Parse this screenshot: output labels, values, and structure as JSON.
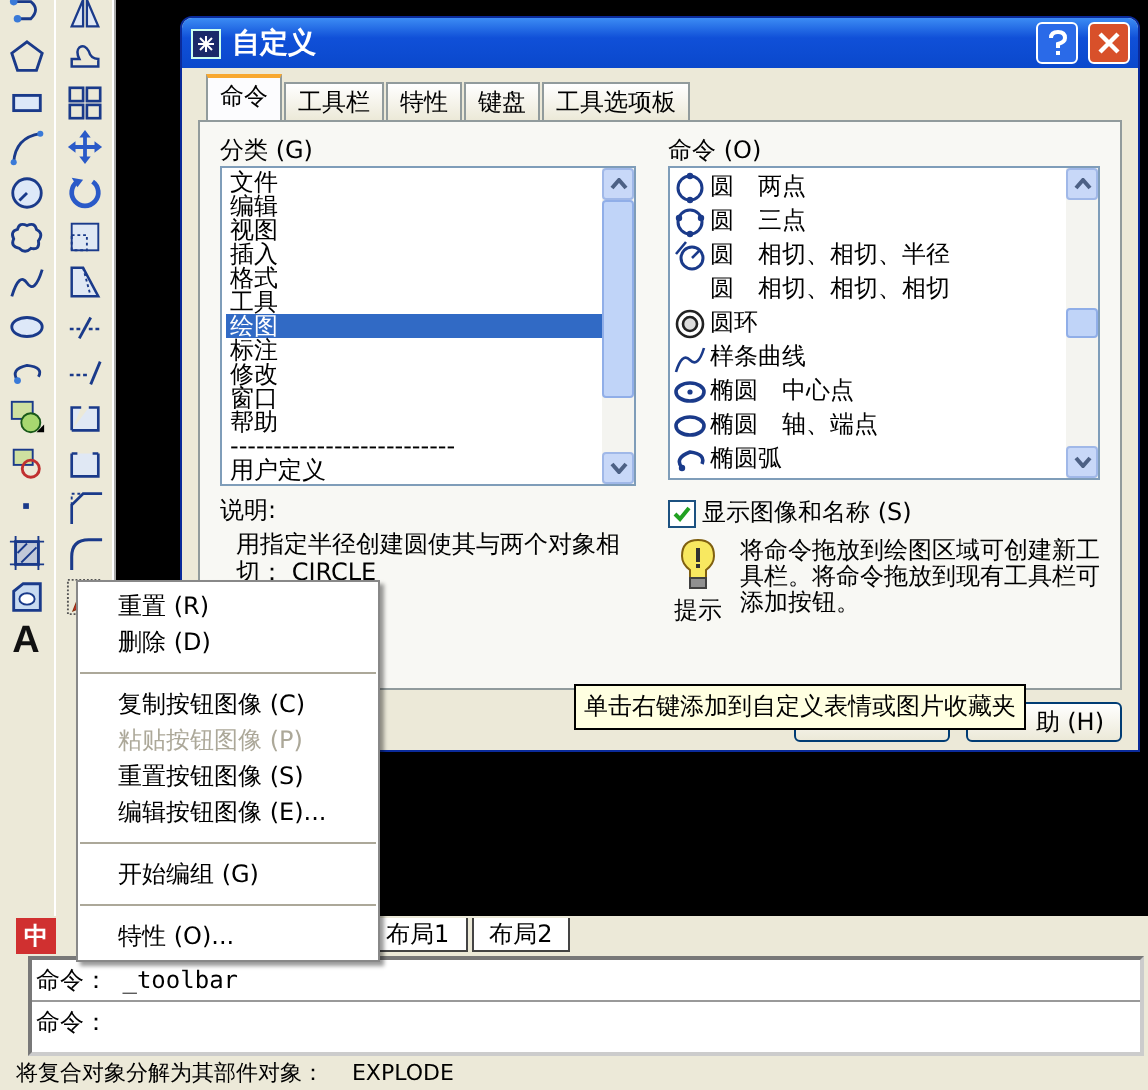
{
  "toolbar": {
    "text_tool_glyph": "A"
  },
  "dialog": {
    "title": "自定义",
    "tabs": [
      {
        "label": "命令",
        "selected": true
      },
      {
        "label": "工具栏",
        "selected": false
      },
      {
        "label": "特性",
        "selected": false
      },
      {
        "label": "键盘",
        "selected": false
      },
      {
        "label": "工具选项板",
        "selected": false
      }
    ],
    "categories": {
      "label": "分类 (G)",
      "items": [
        {
          "label": "文件",
          "selected": false
        },
        {
          "label": "编辑",
          "selected": false
        },
        {
          "label": "视图",
          "selected": false
        },
        {
          "label": "插入",
          "selected": false
        },
        {
          "label": "格式",
          "selected": false
        },
        {
          "label": "工具",
          "selected": false
        },
        {
          "label": "绘图",
          "selected": true
        },
        {
          "label": "标注",
          "selected": false
        },
        {
          "label": "修改",
          "selected": false
        },
        {
          "label": "窗口",
          "selected": false
        },
        {
          "label": "帮助",
          "selected": false
        },
        {
          "label": "--------------------------",
          "selected": false
        },
        {
          "label": "用户定义",
          "selected": false
        }
      ]
    },
    "description": {
      "label": "说明:",
      "text": "用指定半径创建圆使其与两个对象相切：  CIRCLE"
    },
    "commands": {
      "label": "命令 (O)",
      "items": [
        {
          "kind": "circle-2p",
          "label": "圆　两点"
        },
        {
          "kind": "circle-3p",
          "label": "圆　三点"
        },
        {
          "kind": "circle-ttr",
          "label": "圆　相切、相切、半径"
        },
        {
          "kind": "none",
          "label": "圆　相切、相切、相切"
        },
        {
          "kind": "donut",
          "label": "圆环"
        },
        {
          "kind": "spline",
          "label": "样条曲线"
        },
        {
          "kind": "ellipse-center",
          "label": "椭圆　中心点"
        },
        {
          "kind": "ellipse-axis",
          "label": "椭圆　轴、端点"
        },
        {
          "kind": "ellipse-arc",
          "label": "椭圆弧"
        }
      ]
    },
    "show_images": {
      "label": "显示图像和名称 (S)",
      "checked": true
    },
    "hint": {
      "text": "将命令拖放到绘图区域可创建新工具栏。将命令拖放到现有工具栏可添加按钮。",
      "caption": "提示"
    },
    "buttons": [
      "助 (H)"
    ]
  },
  "context_menu": {
    "items": [
      {
        "kind": "item",
        "label": "重置 (R)",
        "disabled": false
      },
      {
        "kind": "item",
        "label": "删除 (D)",
        "disabled": false
      },
      {
        "kind": "separator"
      },
      {
        "kind": "item",
        "label": "复制按钮图像 (C)",
        "disabled": false
      },
      {
        "kind": "item",
        "label": "粘贴按钮图像 (P)",
        "disabled": true
      },
      {
        "kind": "item",
        "label": "重置按钮图像 (S)",
        "disabled": false
      },
      {
        "kind": "item",
        "label": "编辑按钮图像 (E)...",
        "disabled": false
      },
      {
        "kind": "separator"
      },
      {
        "kind": "item",
        "label": "开始编组 (G)",
        "disabled": false
      },
      {
        "kind": "separator"
      },
      {
        "kind": "item",
        "label": "特性 (O)...",
        "disabled": false
      }
    ]
  },
  "tooltip": "单击右键添加到自定义表情或图片收藏夹",
  "ime_indicator": "中",
  "layout_tabs": [
    {
      "label": "布局1"
    },
    {
      "label": "布局2"
    }
  ],
  "command_lines": [
    "命令： _toolbar",
    "命令："
  ],
  "status": "将复合对象分解为其部件对象：    EXPLODE"
}
